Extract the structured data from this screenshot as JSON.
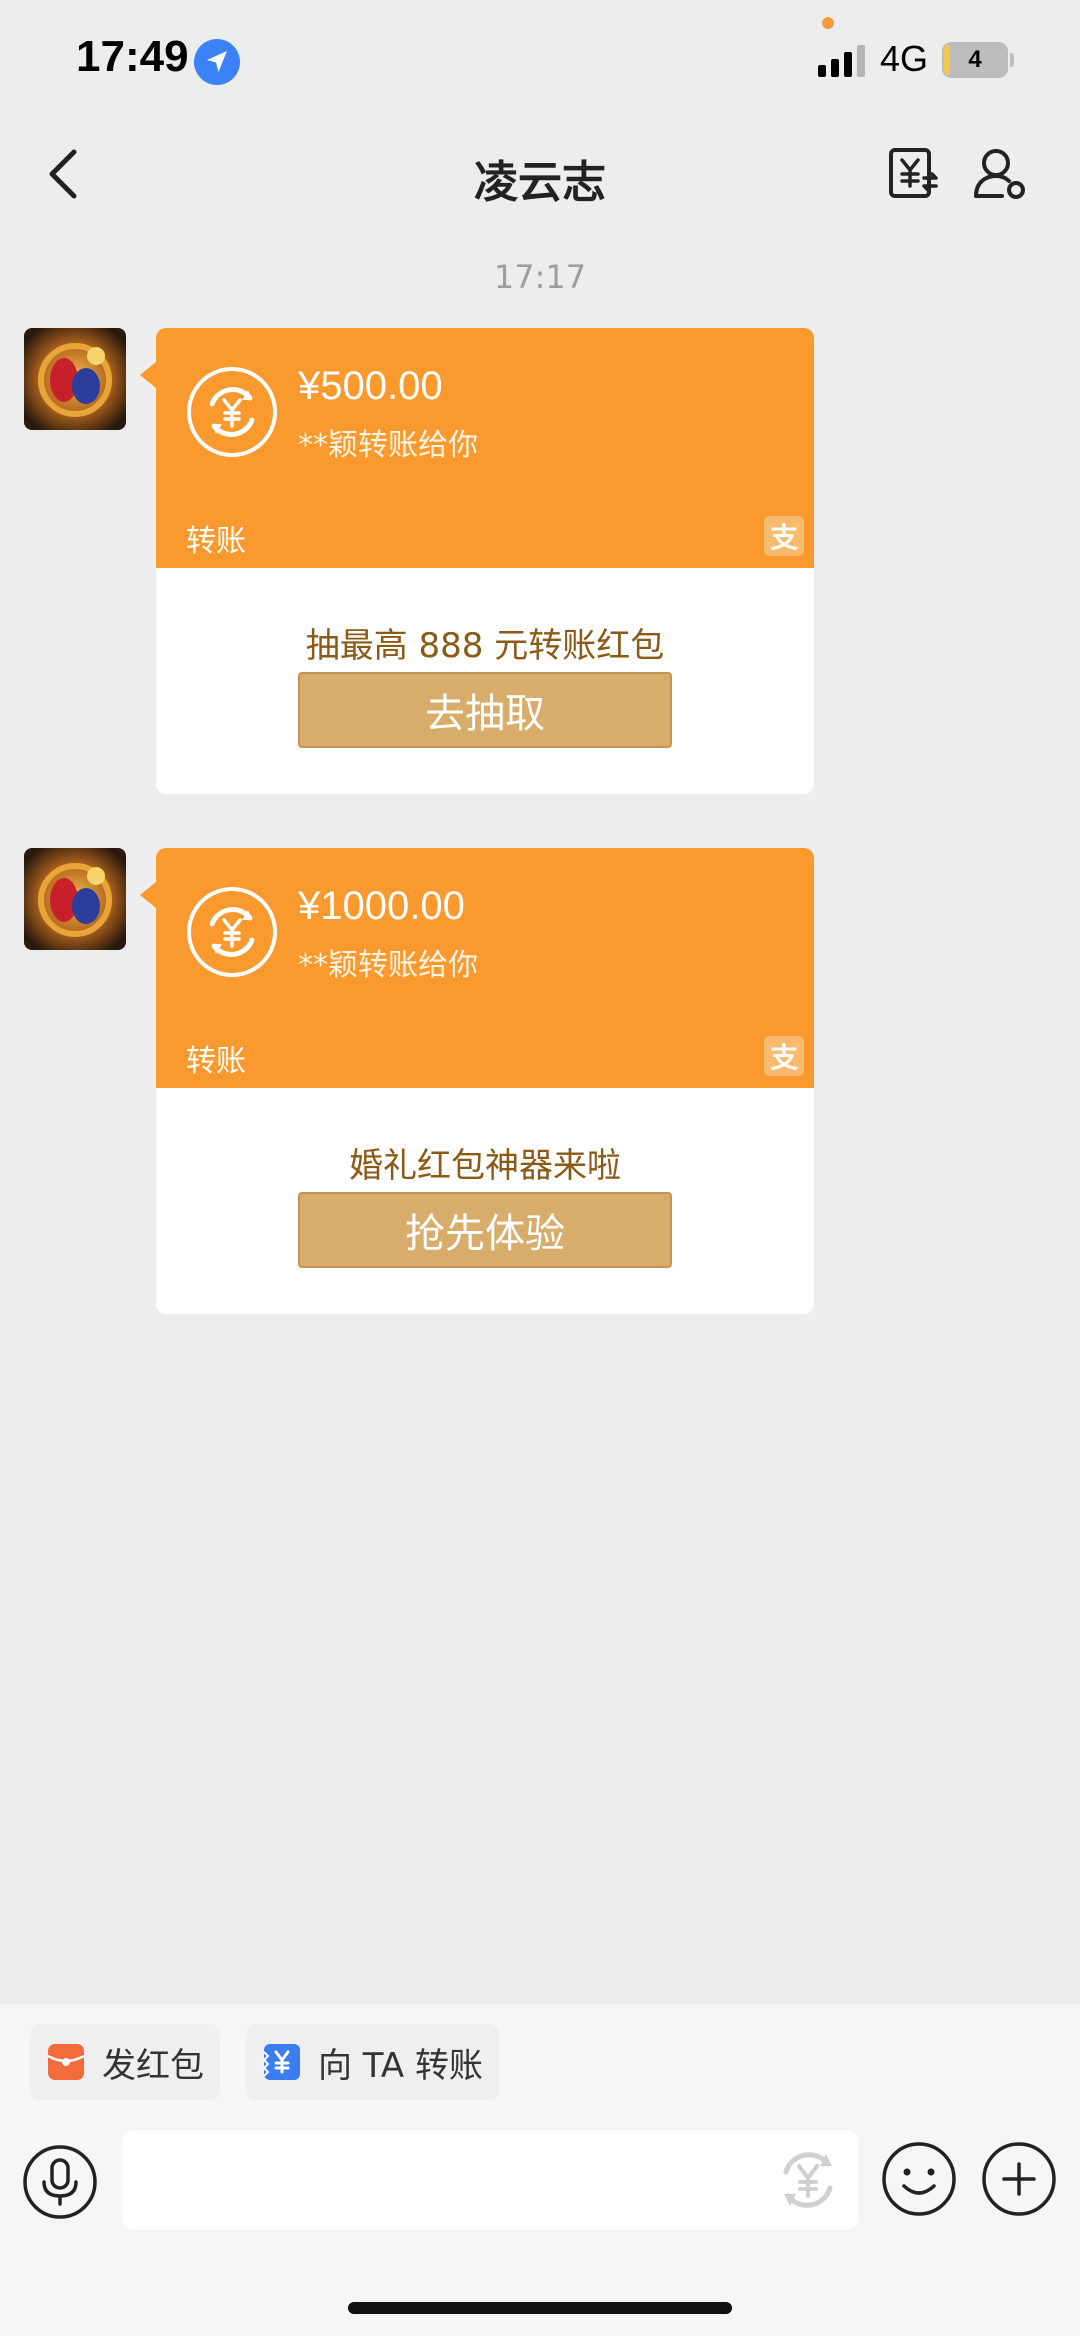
{
  "status_bar": {
    "time": "17:49",
    "network": "4G",
    "battery": "4"
  },
  "header": {
    "title": "凌云志"
  },
  "chat": {
    "timestamp": "17:17",
    "messages": [
      {
        "amount": "¥500.00",
        "subtitle": "**颖转账给你",
        "type_label": "转账",
        "brand_glyph": "支",
        "promo_text": "抽最高 888 元转账红包",
        "button_label": "去抽取"
      },
      {
        "amount": "¥1000.00",
        "subtitle": "**颖转账给你",
        "type_label": "转账",
        "brand_glyph": "支",
        "promo_text": "婚礼红包神器来啦",
        "button_label": "抢先体验"
      }
    ]
  },
  "quick_actions": [
    {
      "label": "发红包",
      "icon": "red-packet-icon",
      "color": "#f26b3a"
    },
    {
      "label": "向 TA 转账",
      "icon": "transfer-icon",
      "color": "#3b7cf0"
    }
  ],
  "input_bar": {
    "placeholder": ""
  },
  "colors": {
    "accent": "#fa9a2e",
    "button": "#d8ac6a",
    "promo_text": "#8a5a16",
    "background": "#ededed"
  }
}
